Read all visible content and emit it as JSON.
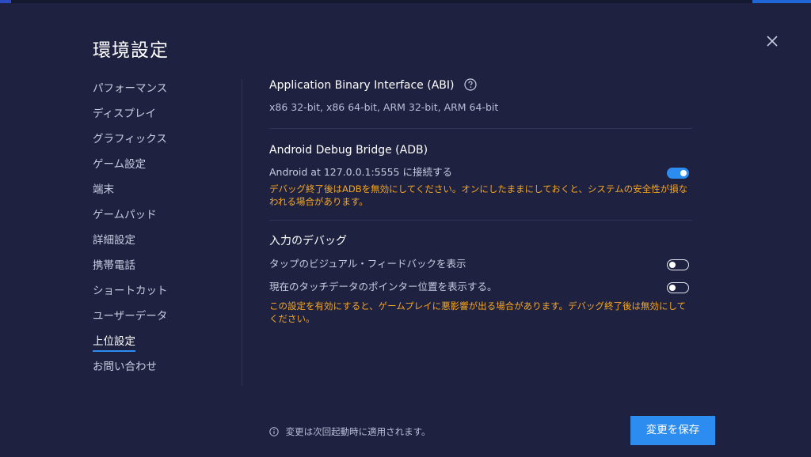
{
  "window": {
    "title": "環境設定"
  },
  "icons": {
    "close": "close-icon",
    "help": "question-circle-icon",
    "info": "info-circle-icon"
  },
  "colors": {
    "background": "#1e2240",
    "accent": "#2d8cf0",
    "warning": "#f5a623"
  },
  "sidebar": {
    "items": [
      {
        "label": "パフォーマンス",
        "active": false
      },
      {
        "label": "ディスプレイ",
        "active": false
      },
      {
        "label": "グラフィックス",
        "active": false
      },
      {
        "label": "ゲーム設定",
        "active": false
      },
      {
        "label": "端末",
        "active": false
      },
      {
        "label": "ゲームパッド",
        "active": false
      },
      {
        "label": "詳細設定",
        "active": false
      },
      {
        "label": "携帯電話",
        "active": false
      },
      {
        "label": "ショートカット",
        "active": false
      },
      {
        "label": "ユーザーデータ",
        "active": false
      },
      {
        "label": "上位設定",
        "active": true
      },
      {
        "label": "お問い合わせ",
        "active": false
      }
    ]
  },
  "abi": {
    "title": "Application Binary Interface (ABI)",
    "value": "x86 32-bit, x86 64-bit, ARM 32-bit, ARM 64-bit"
  },
  "adb": {
    "title": "Android Debug Bridge (ADB)",
    "connect_label": "Android at 127.0.0.1:5555 に接続する",
    "connect_enabled": true,
    "warning": "デバッグ終了後はADBを無効にしてください。オンにしたままにしておくと、システムの安全性が損なわれる場合があります。"
  },
  "input_debug": {
    "title": "入力のデバッグ",
    "tap_feedback_label": "タップのビジュアル・フィードバックを表示",
    "tap_feedback_enabled": false,
    "pointer_location_label": "現在のタッチデータのポインター位置を表示する。",
    "pointer_location_enabled": false,
    "warning": "この設定を有効にすると、ゲームプレイに悪影響が出る場合があります。デバッグ終了後は無効にしてください。"
  },
  "footer": {
    "note": "変更は次回起動時に適用されます。",
    "save_label": "変更を保存"
  }
}
